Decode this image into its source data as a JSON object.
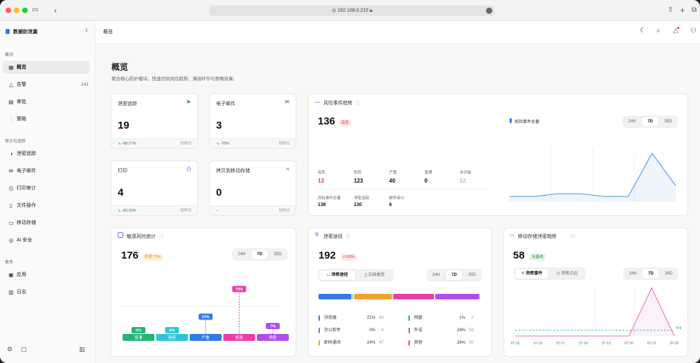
{
  "browser": {
    "url": "192.168.0.215"
  },
  "app": {
    "name": "数据防泄漏"
  },
  "sidebar": {
    "section1": "概况",
    "items1": [
      {
        "label": "概览"
      },
      {
        "label": "告警",
        "count": "141"
      },
      {
        "label": "审批"
      },
      {
        "label": "策略"
      }
    ],
    "section2": "审计与追踪",
    "items2": [
      {
        "label": "泄密追踪"
      },
      {
        "label": "电子邮件"
      },
      {
        "label": "打印审计"
      },
      {
        "label": "文件操作"
      },
      {
        "label": "移动存储"
      },
      {
        "label": "AI 安全"
      }
    ],
    "section3": "更多",
    "items3": [
      {
        "label": "应用"
      },
      {
        "label": "日志"
      }
    ]
  },
  "header": {
    "breadcrumb": "概览"
  },
  "page": {
    "title": "概览",
    "subtitle": "聚合核心防护模块，快速识别风险趋势、薄弱环节与策略效果。"
  },
  "stats": [
    {
      "title": "泄密追踪",
      "value": "19",
      "delta": "↘ -88.27%",
      "period": "较昨日"
    },
    {
      "title": "电子邮件",
      "value": "3",
      "delta": "↘ -70%",
      "period": "较昨日"
    },
    {
      "title": "打印",
      "value": "4",
      "delta": "↘ -83.33%",
      "period": "较昨日"
    },
    {
      "title": "拷贝到移动存储",
      "value": "0",
      "delta": "–",
      "period": "较昨日"
    }
  ],
  "risk": {
    "title": "风险事件趋势",
    "total": "136",
    "badge": "高危",
    "legend": "风险事件总量",
    "tabs": [
      "24H",
      "7D",
      "30D"
    ],
    "levels": [
      {
        "label": "高危",
        "value": "13"
      },
      {
        "label": "危险",
        "value": "123"
      },
      {
        "label": "严重",
        "value": "40"
      },
      {
        "label": "普通",
        "value": "0"
      },
      {
        "label": "未评级",
        "value": "52"
      }
    ],
    "breakdown": [
      {
        "label": "风险事件总量",
        "value": "136"
      },
      {
        "label": "泄密追踪",
        "value": "130"
      },
      {
        "label": "邮件审计",
        "value": "6"
      }
    ],
    "chart_data": {
      "type": "line",
      "series": [
        {
          "name": "风险事件总量",
          "values": [
            2,
            2,
            3,
            3,
            2,
            2,
            18,
            6
          ]
        }
      ],
      "ylim": [
        0,
        20
      ],
      "grid": true
    }
  },
  "sensitive": {
    "title": "敏感风险统计",
    "total": "176",
    "badge": "机密 70%",
    "tabs": [
      "24H",
      "7D",
      "30D"
    ],
    "chart_data": {
      "type": "bar",
      "categories": [
        "普通",
        "秘密",
        "严重",
        "机密",
        "绝密"
      ],
      "values": [
        0,
        0,
        23,
        70,
        7
      ],
      "value_labels": [
        "0%",
        "0%",
        "23%",
        "70%",
        "7%"
      ],
      "colors": [
        "#22b573",
        "#2ec4d6",
        "#2f7bea",
        "#e63fa9",
        "#b04ee8"
      ]
    }
  },
  "channel": {
    "title": "泄密途径",
    "total": "192",
    "badge": "+100%",
    "toggle": [
      "泄密途径",
      "文档类型"
    ],
    "tabs": [
      "24H",
      "7D",
      "30D"
    ],
    "chart_data": {
      "type": "bar",
      "categories": [
        "浏览器",
        "网盘",
        "办公软件",
        "外设",
        "即时通讯",
        "其他"
      ],
      "values": [
        21,
        1,
        0,
        28,
        24,
        26
      ],
      "counts": [
        "40",
        "2",
        "0",
        "53",
        "47",
        "50"
      ],
      "pct": [
        "21%",
        "1%",
        "0%",
        "28%",
        "24%",
        "26%"
      ],
      "colors": [
        "#2f7bea",
        "#22b573",
        "#8e5ee8",
        "#b04ee8",
        "#f0a22a",
        "#e63fa9"
      ]
    }
  },
  "usb": {
    "title": "移动存储泄密趋势",
    "total": "58",
    "badge": "无基线",
    "toggle": [
      "泄密事件",
      "泄密占比"
    ],
    "tabs": [
      "24H",
      "7D",
      "30D"
    ],
    "avg_label": "Avg",
    "chart_data": {
      "type": "line",
      "categories": [
        "07-15",
        "07-16",
        "07-17",
        "07-18",
        "07-19",
        "07-20",
        "07-21",
        "07-22"
      ],
      "series": [
        {
          "name": "泄密事件",
          "values": [
            0,
            0,
            0,
            0,
            0,
            0,
            58,
            0
          ]
        }
      ],
      "ylim": [
        0,
        60
      ],
      "avg": 7
    }
  },
  "colors": {
    "accent": "#2f7bea",
    "danger": "#e03a3a",
    "success": "#1a8a3a"
  }
}
